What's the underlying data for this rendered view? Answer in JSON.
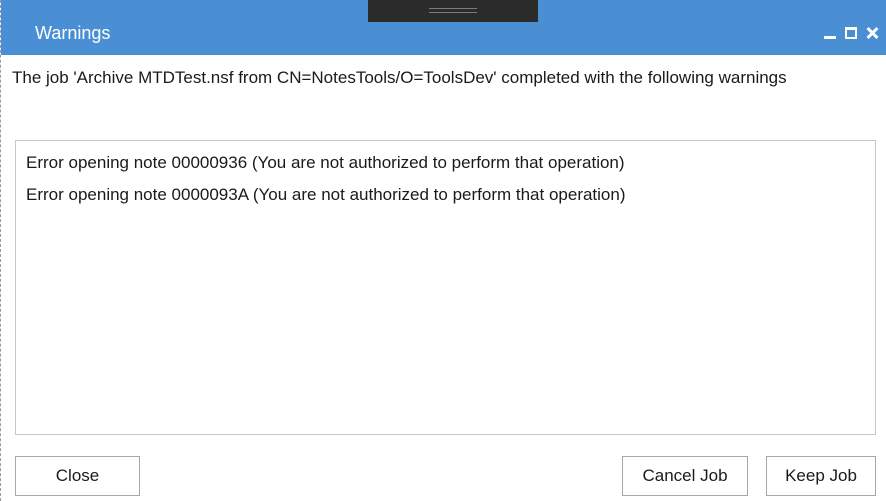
{
  "window": {
    "title": "Warnings"
  },
  "message": "The job 'Archive MTDTest.nsf from CN=NotesTools/O=ToolsDev' completed with the following warnings",
  "warnings": [
    "Error opening note 00000936 (You are not authorized to perform that operation)",
    "Error opening note 0000093A (You are not authorized to perform that operation)"
  ],
  "buttons": {
    "close": "Close",
    "cancel_job": "Cancel Job",
    "keep_job": "Keep Job"
  },
  "colors": {
    "titlebar": "#4a8fd4",
    "title_text": "#ffffff",
    "drag_handle": "#2b2b2b"
  },
  "icons": {
    "minimize": "minimize-icon",
    "maximize": "maximize-icon",
    "close": "close-icon"
  }
}
